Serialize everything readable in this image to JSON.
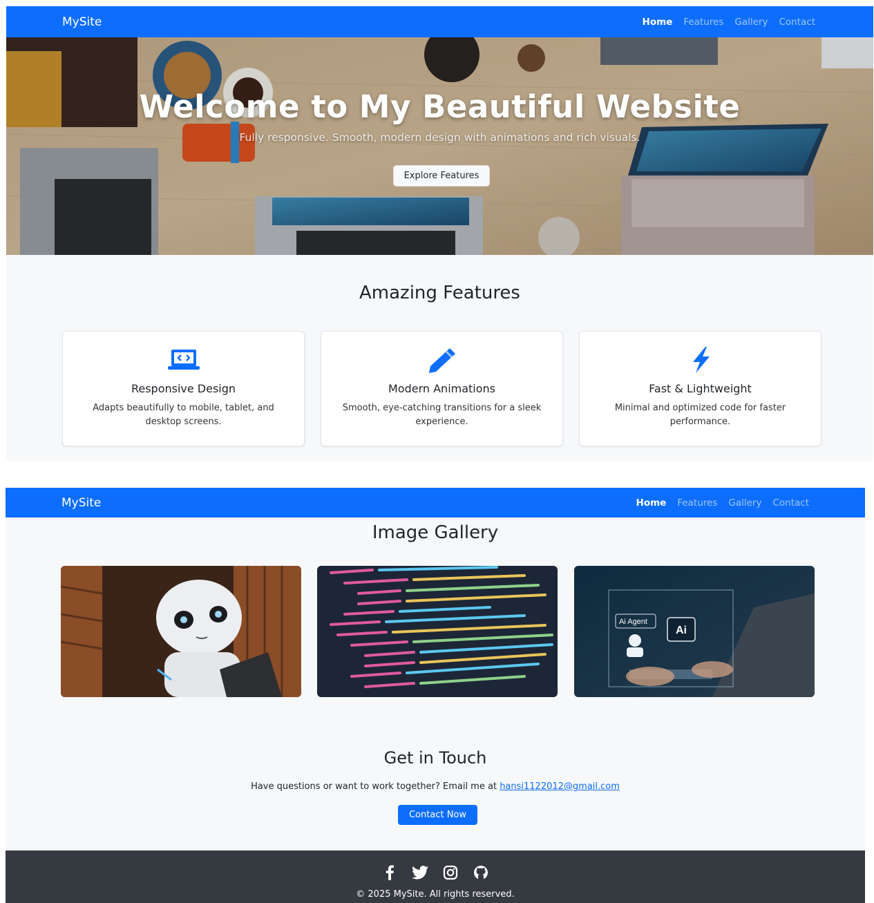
{
  "colors": {
    "primary": "#0d6efd",
    "section_bg": "#f6f8fa",
    "footer_bg": "#343a40"
  },
  "navbar": {
    "brand": "MySite",
    "links": [
      {
        "label": "Home",
        "active": true
      },
      {
        "label": "Features",
        "active": false
      },
      {
        "label": "Gallery",
        "active": false
      },
      {
        "label": "Contact",
        "active": false
      }
    ]
  },
  "hero": {
    "title": "Welcome to My Beautiful Website",
    "subtitle": "Fully responsive. Smooth, modern design with animations and rich visuals.",
    "button_label": "Explore Features"
  },
  "features": {
    "title": "Amazing Features",
    "cards": [
      {
        "icon": "laptop-code-icon",
        "title": "Responsive Design",
        "text": "Adapts beautifully to mobile, tablet, and desktop screens."
      },
      {
        "icon": "pen-icon",
        "title": "Modern Animations",
        "text": "Smooth, eye-catching transitions for a sleek experience."
      },
      {
        "icon": "lightning-icon",
        "title": "Fast & Lightweight",
        "text": "Minimal and optimized code for faster performance."
      }
    ]
  },
  "gallery": {
    "title": "Image Gallery",
    "images": [
      {
        "subject": "robot"
      },
      {
        "subject": "code"
      },
      {
        "subject": "ai-agent",
        "labels": [
          "Ai Agent",
          "Ai"
        ]
      }
    ]
  },
  "contact": {
    "title": "Get in Touch",
    "text": "Have questions or want to work together? Email me at",
    "email": "hansi1122012@gmail.com",
    "button_label": "Contact Now"
  },
  "footer": {
    "socials": [
      "facebook-icon",
      "twitter-icon",
      "instagram-icon",
      "github-icon"
    ],
    "copyright": "© 2025 MySite. All rights reserved."
  }
}
